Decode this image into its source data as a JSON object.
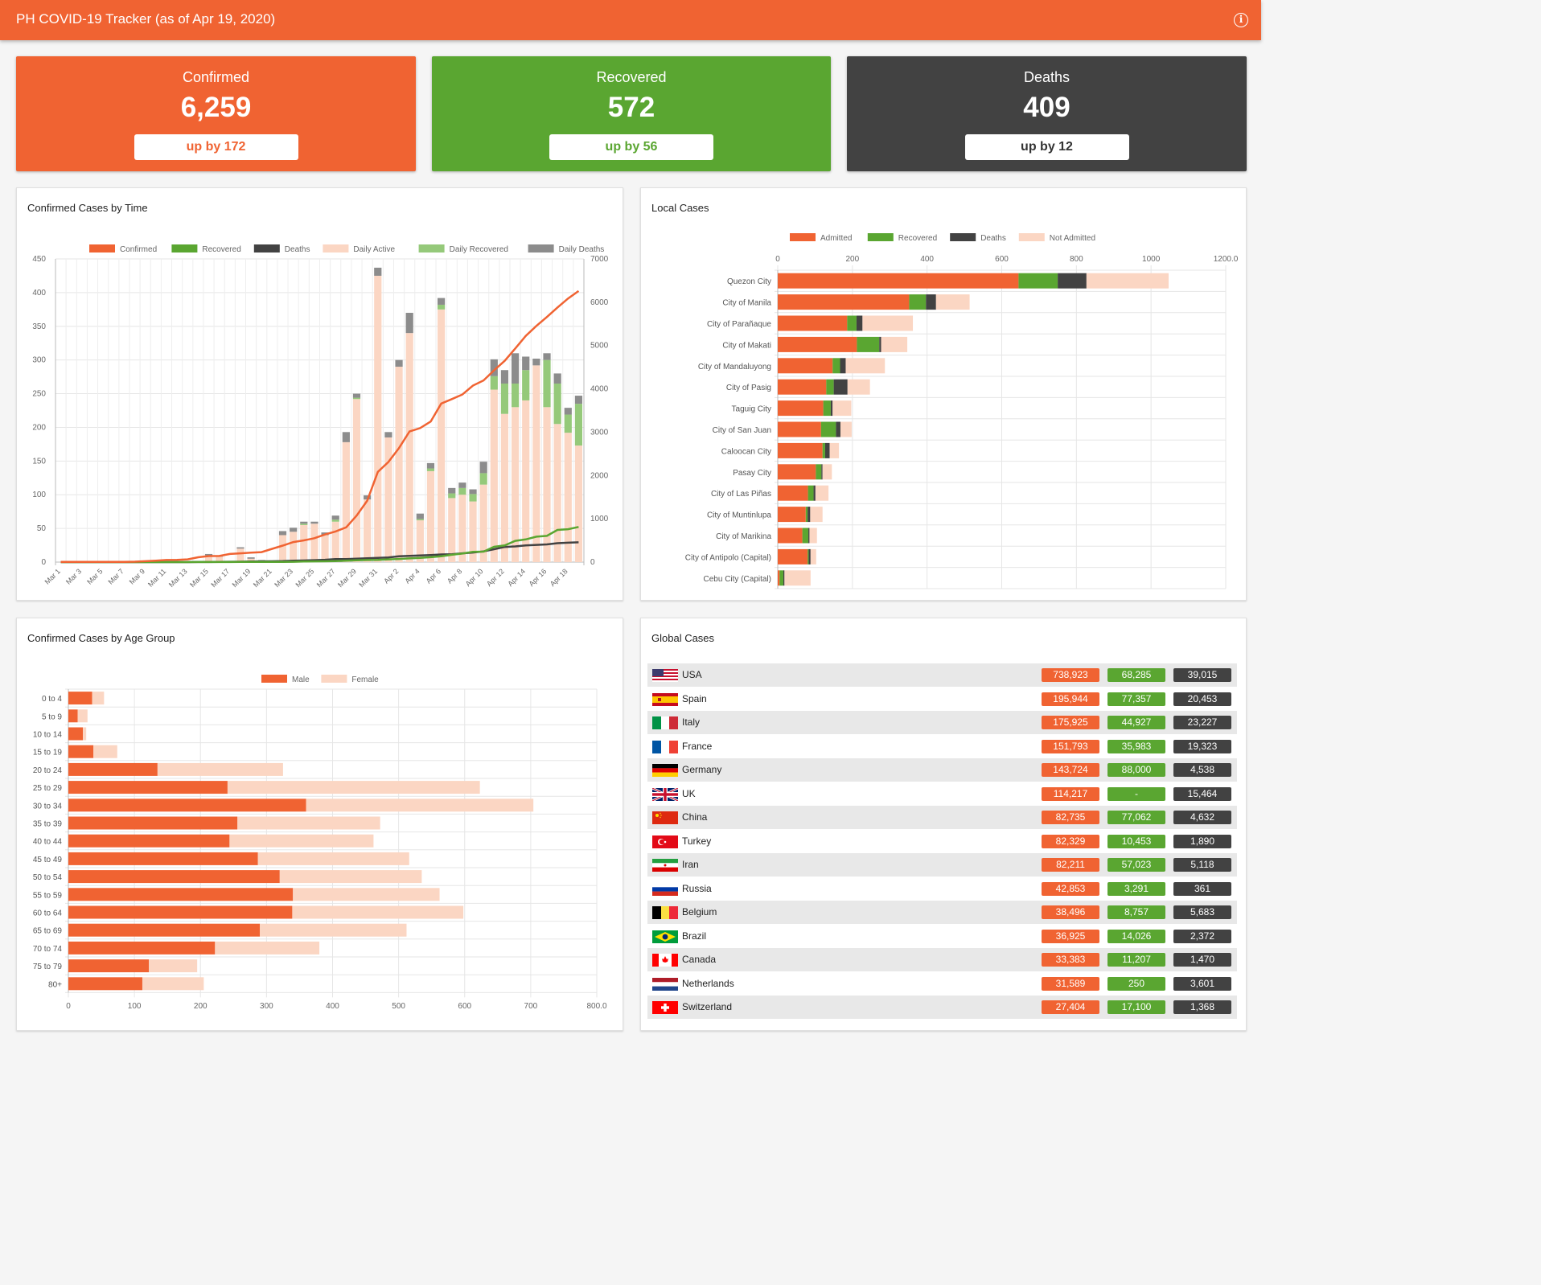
{
  "app": {
    "title": "PH COVID-19 Tracker (as of Apr 19, 2020)",
    "info_icon": "info-icon"
  },
  "colors": {
    "confirmed": "#f06332",
    "recovered": "#5aa631",
    "deaths": "#424242",
    "light_orange": "#fbd6c3",
    "light_green": "#95c97a",
    "gray": "#8c8c8c"
  },
  "stats": [
    {
      "label": "Confirmed",
      "value": "6,259",
      "delta": "up by 172"
    },
    {
      "label": "Recovered",
      "value": "572",
      "delta": "up by 56"
    },
    {
      "label": "Deaths",
      "value": "409",
      "delta": "up by 12"
    }
  ],
  "cards": {
    "time": "Confirmed Cases by Time",
    "local": "Local Cases",
    "age": "Confirmed Cases by Age Group",
    "global": "Global Cases"
  },
  "chart_data": [
    {
      "type": "bar",
      "title": "Confirmed Cases by Time",
      "legend_position": "top",
      "grid": true,
      "x": [
        "Mar 1",
        "Mar 2",
        "Mar 3",
        "Mar 4",
        "Mar 5",
        "Mar 6",
        "Mar 7",
        "Mar 8",
        "Mar 9",
        "Mar 10",
        "Mar 11",
        "Mar 12",
        "Mar 13",
        "Mar 14",
        "Mar 15",
        "Mar 16",
        "Mar 17",
        "Mar 18",
        "Mar 19",
        "Mar 20",
        "Mar 21",
        "Mar 22",
        "Mar 23",
        "Mar 24",
        "Mar 25",
        "Mar 26",
        "Mar 27",
        "Mar 28",
        "Mar 29",
        "Mar 30",
        "Mar 31",
        "Apr 1",
        "Apr 2",
        "Apr 3",
        "Apr 4",
        "Apr 5",
        "Apr 6",
        "Apr 7",
        "Apr 8",
        "Apr 9",
        "Apr 10",
        "Apr 11",
        "Apr 12",
        "Apr 13",
        "Apr 14",
        "Apr 15",
        "Apr 16",
        "Apr 17",
        "Apr 18",
        "Apr 19"
      ],
      "tick_labels": [
        "Mar 1",
        "Mar 3",
        "Mar 5",
        "Mar 7",
        "Mar 9",
        "Mar 11",
        "Mar 13",
        "Mar 15",
        "Mar 17",
        "Mar 19",
        "Mar 21",
        "Mar 23",
        "Mar 25",
        "Mar 27",
        "Mar 29",
        "Mar 31",
        "Apr 2",
        "Apr 4",
        "Apr 6",
        "Apr 8",
        "Apr 10",
        "Apr 12",
        "Apr 14",
        "Apr 16",
        "Apr 18"
      ],
      "y_left_ticks": [
        0,
        50,
        100,
        150,
        200,
        250,
        300,
        350,
        400,
        450
      ],
      "y_right_ticks": [
        0,
        1000,
        2000,
        3000,
        4000,
        5000,
        6000,
        7000
      ],
      "ylim_left": [
        0,
        450
      ],
      "ylim_right": [
        0,
        7000
      ],
      "legend": [
        "Confirmed",
        "Recovered",
        "Deaths",
        "Daily Active",
        "Daily Recovered",
        "Daily Deaths"
      ],
      "series_bars": {
        "daily_active": [
          0,
          0,
          0,
          0,
          0,
          0,
          0,
          0,
          0,
          0,
          0,
          0,
          0,
          0,
          10,
          8,
          0,
          20,
          5,
          2,
          1,
          40,
          45,
          55,
          55,
          40,
          60,
          178,
          242,
          93,
          425,
          185,
          290,
          340,
          60,
          135,
          375,
          95,
          100,
          90,
          115,
          256,
          220,
          230,
          240,
          292,
          230,
          205,
          192,
          173
        ],
        "daily_recovered": [
          0,
          0,
          0,
          0,
          0,
          0,
          0,
          0,
          0,
          0,
          0,
          0,
          0,
          0,
          0,
          0,
          0,
          0,
          0,
          0,
          0,
          0,
          0,
          0,
          0,
          0,
          0,
          0,
          0,
          0,
          0,
          0,
          0,
          0,
          0,
          0,
          0,
          0,
          0,
          0,
          0,
          0,
          0,
          0,
          0,
          0,
          0,
          0,
          0,
          0
        ],
        "daily_deaths": [
          0,
          0,
          0,
          0,
          0,
          0,
          0,
          0,
          0,
          0,
          0,
          0,
          0,
          0,
          0,
          0,
          0,
          0,
          0,
          0,
          0,
          0,
          0,
          0,
          0,
          0,
          0,
          0,
          0,
          0,
          0,
          0,
          0,
          0,
          0,
          0,
          0,
          0,
          0,
          0,
          0,
          0,
          0,
          0,
          0,
          0,
          0,
          0,
          0,
          0
        ]
      },
      "bar_stacks": {
        "active": [
          0,
          0,
          0,
          0,
          0,
          0,
          0,
          0,
          0,
          0,
          0,
          0,
          0,
          0,
          10,
          8,
          0,
          20,
          5,
          2,
          2,
          40,
          45,
          55,
          57,
          40,
          60,
          178,
          242,
          93,
          425,
          185,
          290,
          340,
          62,
          135,
          375,
          95,
          100,
          90,
          115,
          256,
          220,
          230,
          240,
          292,
          230,
          205,
          192,
          173
        ],
        "recovered": [
          0,
          0,
          0,
          0,
          0,
          0,
          0,
          0,
          0,
          0,
          0,
          0,
          0,
          0,
          0,
          0,
          0,
          0,
          0,
          0,
          0,
          0,
          0,
          2,
          0,
          0,
          3,
          0,
          2,
          0,
          0,
          0,
          0,
          0,
          2,
          4,
          7,
          7,
          10,
          11,
          17,
          20,
          45,
          35,
          45,
          0,
          70,
          60,
          27,
          62
        ],
        "deaths": [
          0,
          0,
          0,
          0,
          0,
          0,
          0,
          0,
          0,
          0,
          0,
          0,
          0,
          0,
          2,
          2,
          0,
          2,
          2,
          1,
          0,
          6,
          6,
          3,
          3,
          4,
          6,
          15,
          6,
          6,
          12,
          8,
          10,
          30,
          8,
          8,
          10,
          8,
          8,
          7,
          17,
          25,
          20,
          45,
          20,
          10,
          10,
          15,
          10,
          12
        ]
      },
      "cumulative": {
        "confirmed": [
          3,
          3,
          3,
          3,
          5,
          5,
          6,
          10,
          20,
          33,
          49,
          52,
          64,
          111,
          140,
          142,
          187,
          202,
          217,
          230,
          307,
          380,
          462,
          501,
          552,
          636,
          707,
          803,
          1075,
          1418,
          2084,
          2311,
          2633,
          3018,
          3094,
          3246,
          3660,
          3764,
          3870,
          4076,
          4195,
          4428,
          4648,
          4932,
          5223,
          5453,
          5660,
          5878,
          6087,
          6259
        ],
        "recovered": [
          0,
          0,
          0,
          0,
          0,
          0,
          0,
          0,
          0,
          0,
          0,
          0,
          0,
          2,
          2,
          2,
          2,
          4,
          4,
          4,
          4,
          4,
          8,
          13,
          17,
          18,
          24,
          31,
          42,
          49,
          52,
          64,
          73,
          85,
          96,
          114,
          136,
          169,
          197,
          238,
          242,
          353,
          384,
          490,
          524,
          587,
          606,
          742,
          759,
          812
        ],
        "deaths": [
          0,
          0,
          0,
          0,
          0,
          0,
          0,
          0,
          0,
          0,
          0,
          0,
          0,
          1,
          1,
          3,
          8,
          9,
          14,
          17,
          19,
          22,
          33,
          38,
          45,
          54,
          68,
          71,
          78,
          88,
          96,
          107,
          136,
          144,
          152,
          163,
          177,
          182,
          203,
          221,
          247,
          297,
          349,
          362,
          387,
          397,
          409,
          437,
          447,
          456
        ]
      }
    },
    {
      "type": "bar",
      "title": "Local Cases",
      "orientation": "horizontal",
      "stacked": true,
      "legend_position": "top",
      "legend": [
        "Admitted",
        "Recovered",
        "Deaths",
        "Not Admitted"
      ],
      "xlim": [
        0,
        1200
      ],
      "x_ticks": [
        "0",
        "200",
        "400",
        "600",
        "800",
        "1000",
        "1200.0"
      ],
      "categories": [
        "Quezon City",
        "City of Manila",
        "City of Parañaque",
        "City of Makati",
        "City of Mandaluyong",
        "City of Pasig",
        "Taguig City",
        "City of San Juan",
        "Caloocan City",
        "Pasay City",
        "City of Las Piñas",
        "City of Muntinlupa",
        "City of Marikina",
        "City of Antipolo (Capital)",
        "Cebu City (Capital)"
      ],
      "series": [
        {
          "name": "Admitted",
          "values": [
            645,
            352,
            186,
            212,
            147,
            130,
            122,
            116,
            120,
            102,
            81,
            75,
            66,
            80,
            5
          ]
        },
        {
          "name": "Recovered",
          "values": [
            105,
            45,
            25,
            60,
            20,
            20,
            20,
            40,
            7,
            15,
            15,
            5,
            16,
            3,
            10
          ]
        },
        {
          "name": "Deaths",
          "values": [
            77,
            27,
            16,
            5,
            15,
            37,
            5,
            12,
            12,
            3,
            5,
            7,
            3,
            5,
            3
          ]
        },
        {
          "name": "Not Admitted",
          "values": [
            220,
            90,
            135,
            70,
            105,
            60,
            50,
            30,
            25,
            25,
            35,
            33,
            20,
            15,
            70
          ]
        }
      ]
    },
    {
      "type": "bar",
      "title": "Confirmed Cases by Age Group",
      "orientation": "horizontal",
      "stacked": true,
      "legend_position": "top",
      "legend": [
        "Male",
        "Female"
      ],
      "xlim": [
        0,
        800
      ],
      "x_ticks": [
        "0",
        "100",
        "200",
        "300",
        "400",
        "500",
        "600",
        "700",
        "800.0"
      ],
      "categories": [
        "0 to 4",
        "5 to 9",
        "10 to 14",
        "15 to 19",
        "20 to 24",
        "25 to 29",
        "30 to 34",
        "35 to 39",
        "40 to 44",
        "45 to 49",
        "50 to 54",
        "55 to 59",
        "60 to 64",
        "65 to 69",
        "70 to 74",
        "75 to 79",
        "80+"
      ],
      "series": [
        {
          "name": "Male",
          "values": [
            36,
            14,
            22,
            38,
            135,
            241,
            360,
            256,
            244,
            287,
            320,
            340,
            339,
            290,
            222,
            122,
            112
          ]
        },
        {
          "name": "Female",
          "values": [
            18,
            15,
            5,
            36,
            190,
            382,
            344,
            216,
            218,
            229,
            215,
            222,
            259,
            222,
            158,
            73,
            93
          ]
        }
      ]
    }
  ],
  "global_cases": [
    {
      "country": "USA",
      "confirmed": "738,923",
      "recovered": "68,285",
      "deaths": "39,015",
      "flag": "us-flag-icon"
    },
    {
      "country": "Spain",
      "confirmed": "195,944",
      "recovered": "77,357",
      "deaths": "20,453",
      "flag": "es-flag-icon"
    },
    {
      "country": "Italy",
      "confirmed": "175,925",
      "recovered": "44,927",
      "deaths": "23,227",
      "flag": "it-flag-icon"
    },
    {
      "country": "France",
      "confirmed": "151,793",
      "recovered": "35,983",
      "deaths": "19,323",
      "flag": "fr-flag-icon"
    },
    {
      "country": "Germany",
      "confirmed": "143,724",
      "recovered": "88,000",
      "deaths": "4,538",
      "flag": "de-flag-icon"
    },
    {
      "country": "UK",
      "confirmed": "114,217",
      "recovered": "-",
      "deaths": "15,464",
      "flag": "gb-flag-icon"
    },
    {
      "country": "China",
      "confirmed": "82,735",
      "recovered": "77,062",
      "deaths": "4,632",
      "flag": "cn-flag-icon"
    },
    {
      "country": "Turkey",
      "confirmed": "82,329",
      "recovered": "10,453",
      "deaths": "1,890",
      "flag": "tr-flag-icon"
    },
    {
      "country": "Iran",
      "confirmed": "82,211",
      "recovered": "57,023",
      "deaths": "5,118",
      "flag": "ir-flag-icon"
    },
    {
      "country": "Russia",
      "confirmed": "42,853",
      "recovered": "3,291",
      "deaths": "361",
      "flag": "ru-flag-icon"
    },
    {
      "country": "Belgium",
      "confirmed": "38,496",
      "recovered": "8,757",
      "deaths": "5,683",
      "flag": "be-flag-icon"
    },
    {
      "country": "Brazil",
      "confirmed": "36,925",
      "recovered": "14,026",
      "deaths": "2,372",
      "flag": "br-flag-icon"
    },
    {
      "country": "Canada",
      "confirmed": "33,383",
      "recovered": "11,207",
      "deaths": "1,470",
      "flag": "ca-flag-icon"
    },
    {
      "country": "Netherlands",
      "confirmed": "31,589",
      "recovered": "250",
      "deaths": "3,601",
      "flag": "nl-flag-icon"
    },
    {
      "country": "Switzerland",
      "confirmed": "27,404",
      "recovered": "17,100",
      "deaths": "1,368",
      "flag": "ch-flag-icon"
    }
  ]
}
